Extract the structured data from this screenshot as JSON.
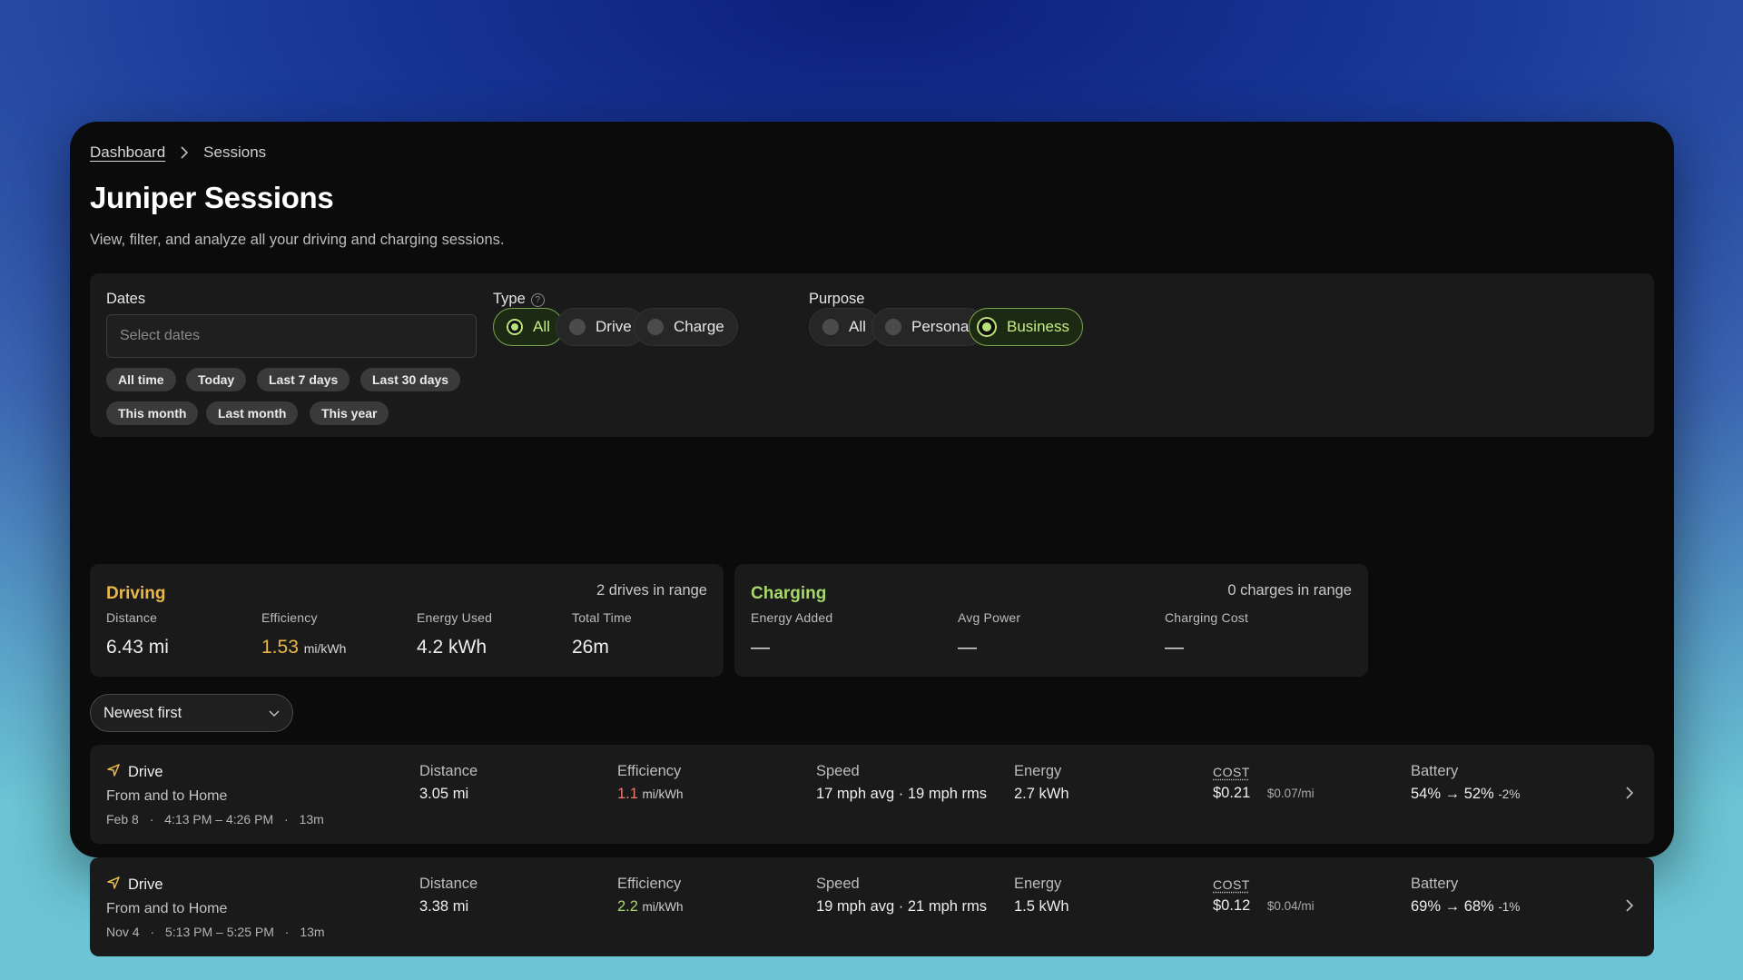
{
  "breadcrumb": {
    "parent": "Dashboard",
    "current": "Sessions"
  },
  "page": {
    "title": "Juniper Sessions",
    "subtitle": "View, filter, and analyze all your driving and charging sessions."
  },
  "filters": {
    "dates_label": "Dates",
    "dates_placeholder": "Select dates",
    "date_chips": [
      "All time",
      "Today",
      "Last 7 days",
      "Last 30 days",
      "This month",
      "Last month",
      "This year"
    ],
    "type_label": "Type",
    "type_options": [
      "All",
      "Drive",
      "Charge"
    ],
    "type_selected": "All",
    "purpose_label": "Purpose",
    "purpose_options": [
      "All",
      "Personal",
      "Business"
    ],
    "purpose_selected": "Business"
  },
  "driving": {
    "title": "Driving",
    "range": "2 drives in range",
    "metrics": [
      {
        "label": "Distance",
        "value": "6.43 mi",
        "unit": ""
      },
      {
        "label": "Efficiency",
        "value": "1.53",
        "unit": "mi/kWh"
      },
      {
        "label": "Energy Used",
        "value": "4.2 kWh",
        "unit": ""
      },
      {
        "label": "Total Time",
        "value": "26m",
        "unit": ""
      }
    ]
  },
  "charging": {
    "title": "Charging",
    "range": "0 charges in range",
    "metrics": [
      {
        "label": "Energy Added",
        "value": "—"
      },
      {
        "label": "Avg Power",
        "value": "—"
      },
      {
        "label": "Charging Cost",
        "value": "—"
      }
    ]
  },
  "sort": {
    "selected": "Newest first"
  },
  "sessions": [
    {
      "type": "Drive",
      "route": "From and to Home",
      "date": "Feb 8",
      "time": "4:13 PM – 4:26 PM",
      "duration": "13m",
      "labels": {
        "distance": "Distance",
        "efficiency": "Efficiency",
        "speed": "Speed",
        "energy": "Energy",
        "cost": "COST",
        "battery": "Battery"
      },
      "distance": "3.05 mi",
      "efficiency": "1.1",
      "efficiency_unit": "mi/kWh",
      "speed": "17 mph avg · 19 mph rms",
      "energy": "2.7 kWh",
      "cost": "$0.21",
      "cost_per_mile": "$0.07/mi",
      "battery": "54% → 52%",
      "battery_delta": "-2%",
      "efficiency_color": "#ef7b6b"
    },
    {
      "type": "Drive",
      "route": "From and to Home",
      "date": "Nov 4",
      "time": "5:13 PM – 5:25 PM",
      "duration": "13m",
      "labels": {
        "distance": "Distance",
        "efficiency": "Efficiency",
        "speed": "Speed",
        "energy": "Energy",
        "cost": "COST",
        "battery": "Battery"
      },
      "distance": "3.38 mi",
      "efficiency": "2.2",
      "efficiency_unit": "mi/kWh",
      "speed": "19 mph avg · 21 mph rms",
      "energy": "1.5 kWh",
      "cost": "$0.12",
      "cost_per_mile": "$0.04/mi",
      "battery": "69% → 68%",
      "battery_delta": "-1%",
      "efficiency_color": "#a6d86a"
    }
  ],
  "colors": {
    "driving_accent": "#e8b84a",
    "charging_accent": "#a6d86a",
    "selected_accent": "#b8e27a"
  },
  "icons": [
    "chevron-right-icon",
    "help-circle-icon",
    "chevron-down-icon",
    "navigation-arrow-icon"
  ]
}
